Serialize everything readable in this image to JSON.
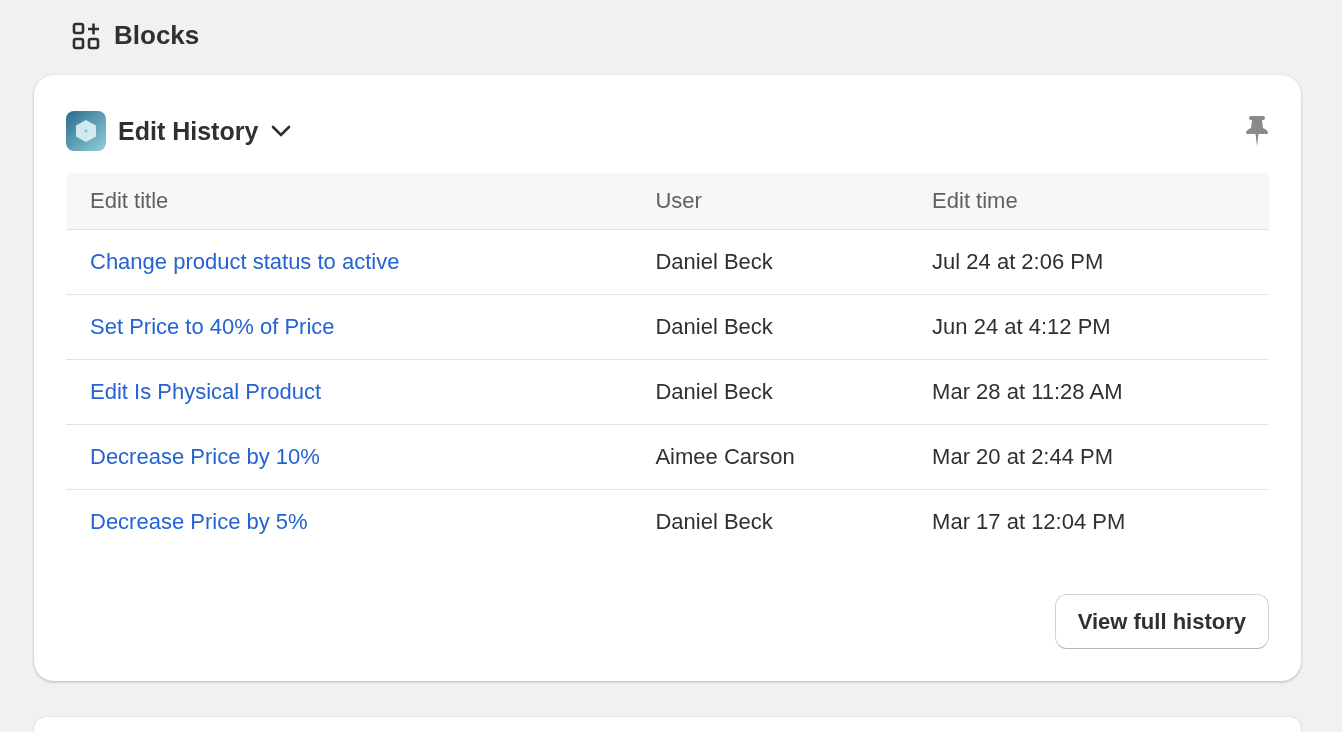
{
  "section": {
    "title": "Blocks"
  },
  "card": {
    "title": "Edit History",
    "table": {
      "columns": [
        "Edit title",
        "User",
        "Edit time"
      ],
      "rows": [
        {
          "title": "Change product status to active",
          "user": "Daniel Beck",
          "time": "Jul 24 at 2:06 PM"
        },
        {
          "title": "Set Price to 40% of Price",
          "user": "Daniel Beck",
          "time": "Jun 24 at 4:12 PM"
        },
        {
          "title": "Edit Is Physical Product",
          "user": "Daniel Beck",
          "time": "Mar 28 at 11:28 AM"
        },
        {
          "title": "Decrease Price by 10%",
          "user": "Aimee Carson",
          "time": "Mar 20 at 2:44 PM"
        },
        {
          "title": "Decrease Price by 5%",
          "user": "Daniel Beck",
          "time": "Mar 17 at 12:04 PM"
        }
      ]
    },
    "button": "View full history"
  }
}
